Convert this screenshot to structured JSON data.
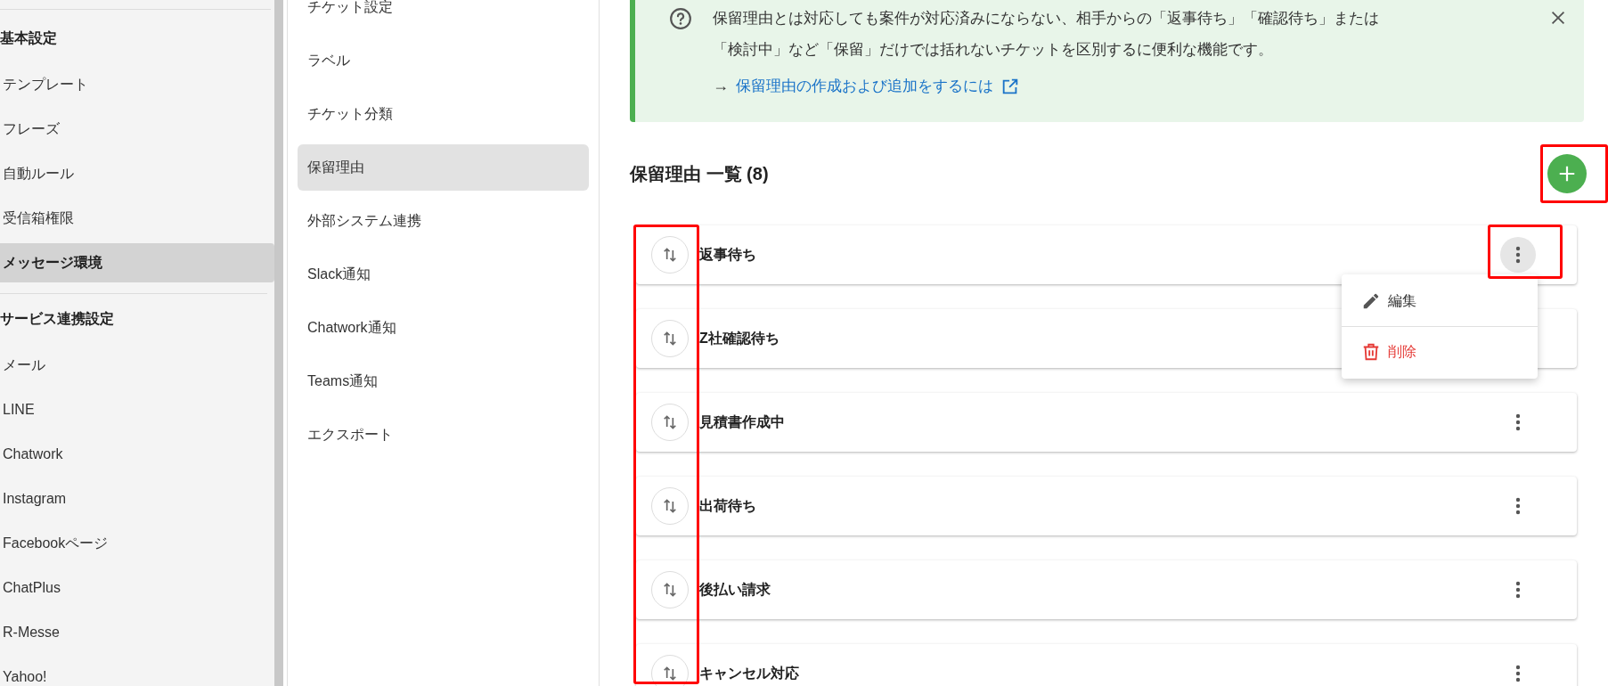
{
  "sidebar": {
    "sections": [
      {
        "title": "基本設定",
        "items": [
          {
            "label": "テンプレート",
            "selected": false
          },
          {
            "label": "フレーズ",
            "selected": false
          },
          {
            "label": "自動ルール",
            "selected": false
          },
          {
            "label": "受信箱権限",
            "selected": false
          },
          {
            "label": "メッセージ環境",
            "selected": true
          }
        ]
      },
      {
        "title": "サービス連携設定",
        "items": [
          {
            "label": "メール",
            "selected": false
          },
          {
            "label": "LINE",
            "selected": false
          },
          {
            "label": "Chatwork",
            "selected": false
          },
          {
            "label": "Instagram",
            "selected": false
          },
          {
            "label": "Facebookページ",
            "selected": false
          },
          {
            "label": "ChatPlus",
            "selected": false
          },
          {
            "label": "R-Messe",
            "selected": false
          },
          {
            "label": "Yahoo!",
            "selected": false
          }
        ]
      }
    ]
  },
  "subnav": {
    "items": [
      {
        "label": "チケット設定",
        "selected": false
      },
      {
        "label": "ラベル",
        "selected": false
      },
      {
        "label": "チケット分類",
        "selected": false
      },
      {
        "label": "保留理由",
        "selected": true
      },
      {
        "label": "外部システム連携",
        "selected": false
      },
      {
        "label": "Slack通知",
        "selected": false
      },
      {
        "label": "Chatwork通知",
        "selected": false
      },
      {
        "label": "Teams通知",
        "selected": false
      },
      {
        "label": "エクスポート",
        "selected": false
      }
    ]
  },
  "banner": {
    "text": "保留理由とは対応しても案件が対応済みにならない、相手からの「返事待ち」「確認待ち」または「検討中」など「保留」だけでは括れないチケットを区別するに便利な機能です。",
    "link_arrow": "→",
    "link": "保留理由の作成および追加をするには"
  },
  "list": {
    "title": "保留理由 一覧 (8)",
    "rows": [
      {
        "label": "返事待ち",
        "menu_open": true
      },
      {
        "label": "Z社確認待ち",
        "menu_open": false
      },
      {
        "label": "見積書作成中",
        "menu_open": false
      },
      {
        "label": "出荷待ち",
        "menu_open": false
      },
      {
        "label": "後払い請求",
        "menu_open": false
      },
      {
        "label": "キャンセル対応",
        "menu_open": false
      }
    ]
  },
  "menu": {
    "items": [
      {
        "kind": "edit",
        "label": "編集"
      },
      {
        "kind": "delete",
        "label": "削除"
      }
    ]
  }
}
